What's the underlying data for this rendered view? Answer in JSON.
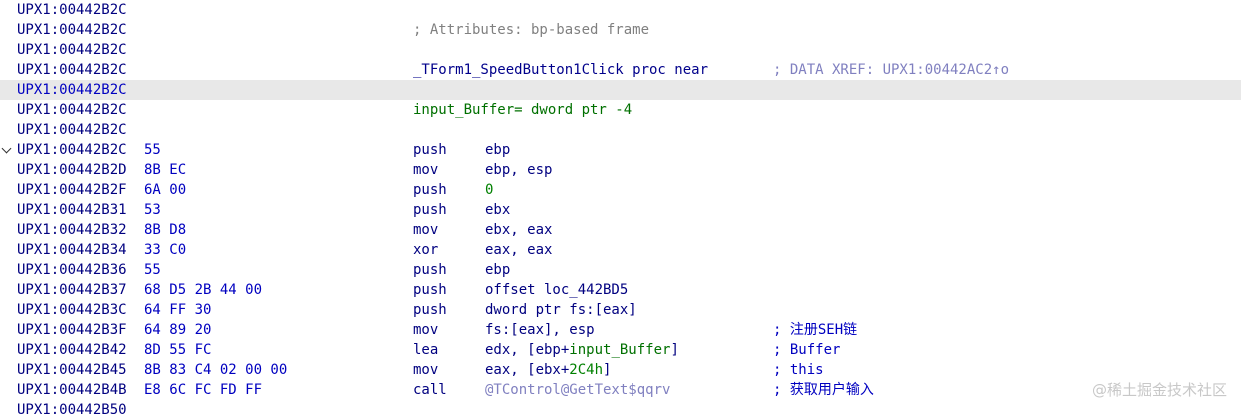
{
  "rows": [
    {
      "addr": "UPX1:00442B2C"
    },
    {
      "addr": "UPX1:00442B2C",
      "attr": "; Attributes: bp-based frame"
    },
    {
      "addr": "UPX1:00442B2C"
    },
    {
      "addr": "UPX1:00442B2C",
      "label": "_TForm1_SpeedButton1Click proc near",
      "xref": "; DATA XREF: UPX1:00442AC2↑o"
    },
    {
      "addr": "UPX1:00442B2C",
      "selected": true
    },
    {
      "addr": "UPX1:00442B2C",
      "var": "input_Buffer= dword ptr -4"
    },
    {
      "addr": "UPX1:00442B2C"
    },
    {
      "addr": "UPX1:00442B2C",
      "bytes": "55",
      "mnem": "push",
      "op": "ebp",
      "chevron": true
    },
    {
      "addr": "UPX1:00442B2D",
      "bytes": "8B EC",
      "mnem": "mov",
      "op": "ebp, esp"
    },
    {
      "addr": "UPX1:00442B2F",
      "bytes": "6A 00",
      "mnem": "push",
      "op_num": "0"
    },
    {
      "addr": "UPX1:00442B31",
      "bytes": "53",
      "mnem": "push",
      "op": "ebx"
    },
    {
      "addr": "UPX1:00442B32",
      "bytes": "8B D8",
      "mnem": "mov",
      "op": "ebx, eax"
    },
    {
      "addr": "UPX1:00442B34",
      "bytes": "33 C0",
      "mnem": "xor",
      "op": "eax, eax"
    },
    {
      "addr": "UPX1:00442B36",
      "bytes": "55",
      "mnem": "push",
      "op": "ebp"
    },
    {
      "addr": "UPX1:00442B37",
      "bytes": "68 D5 2B 44 00",
      "mnem": "push",
      "op": "offset loc_442BD5"
    },
    {
      "addr": "UPX1:00442B3C",
      "bytes": "64 FF 30",
      "mnem": "push",
      "op": "dword ptr fs:[eax]"
    },
    {
      "addr": "UPX1:00442B3F",
      "bytes": "64 89 20",
      "mnem": "mov",
      "op": "fs:[eax], esp",
      "comment": "; 注册SEH链"
    },
    {
      "addr": "UPX1:00442B42",
      "bytes": "8D 55 FC",
      "mnem": "lea",
      "op_pre": "edx, [ebp+",
      "op_var": "input_Buffer",
      "op_post": "]",
      "comment": "; Buffer"
    },
    {
      "addr": "UPX1:00442B45",
      "bytes": "8B 83 C4 02 00 00",
      "mnem": "mov",
      "op_pre": "eax, [ebx+",
      "op_numin": "2C4h",
      "op_post": "]",
      "comment": "; this"
    },
    {
      "addr": "UPX1:00442B4B",
      "bytes": "E8 6C FC FD FF",
      "mnem": "call",
      "op_func": "@TControl@GetText$qqrv",
      "comment": "; 获取用户输入"
    },
    {
      "addr": "UPX1:00442B50"
    }
  ],
  "watermark": "@稀土掘金技术社区",
  "colors": {
    "selected_row_bg": "#e8e8e8",
    "address": "#000080",
    "bytes": "#0000c0",
    "comment": "#0000c0",
    "number": "#008000",
    "xref": "#8080c0"
  }
}
